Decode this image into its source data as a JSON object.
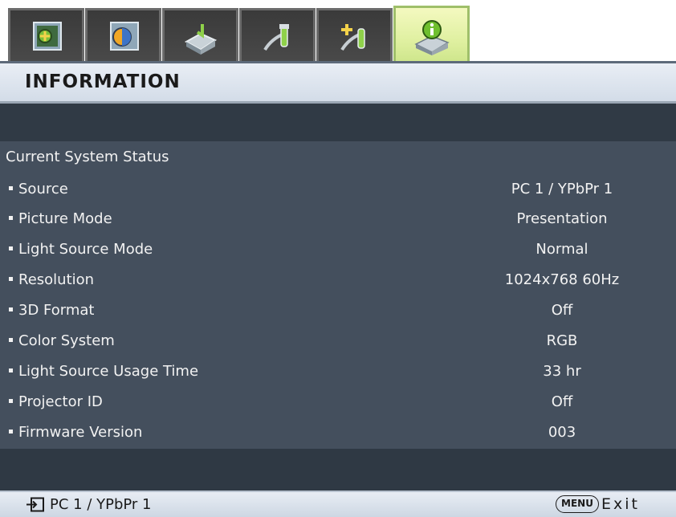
{
  "tabs": [
    {
      "icon": "picture-settings-icon",
      "active": false
    },
    {
      "icon": "advanced-picture-icon",
      "active": false
    },
    {
      "icon": "display-settings-icon",
      "active": false
    },
    {
      "icon": "system-setup-basic-icon",
      "active": false
    },
    {
      "icon": "system-setup-advanced-icon",
      "active": false
    },
    {
      "icon": "information-icon",
      "active": true
    }
  ],
  "header": {
    "title": "INFORMATION"
  },
  "status": {
    "section_title": "Current System Status",
    "rows": [
      {
        "label": "Source",
        "value": "PC 1 / YPbPr 1"
      },
      {
        "label": "Picture Mode",
        "value": "Presentation"
      },
      {
        "label": "Light Source Mode",
        "value": "Normal"
      },
      {
        "label": "Resolution",
        "value": "1024x768 60Hz"
      },
      {
        "label": "3D Format",
        "value": "Off"
      },
      {
        "label": "Color System",
        "value": "RGB"
      },
      {
        "label": "Light Source Usage Time",
        "value": "33 hr"
      },
      {
        "label": "Projector ID",
        "value": "Off"
      },
      {
        "label": "Firmware Version",
        "value": "003"
      }
    ]
  },
  "footer": {
    "source_icon": "input-source-icon",
    "source": "PC 1 / YPbPr 1",
    "menu_key": "MENU",
    "exit_label": "Exit"
  },
  "colors": {
    "active_tab": "#dff0a0",
    "panel_bg": "#444f5d",
    "dark_strip": "#303a45",
    "header_bg": "#dde4ee"
  }
}
